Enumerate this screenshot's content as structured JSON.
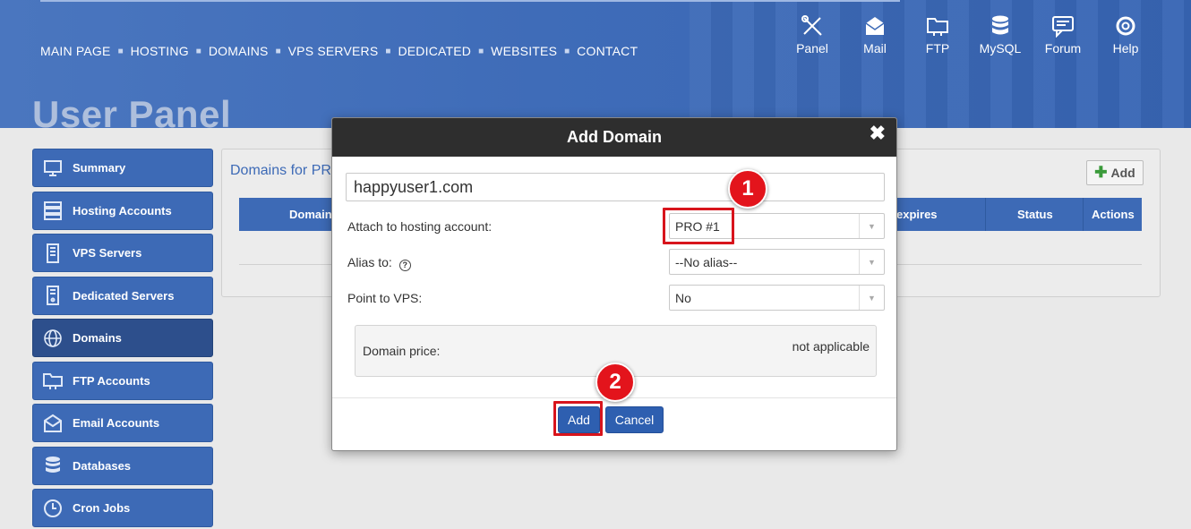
{
  "nav": {
    "items": [
      "MAIN PAGE",
      "HOSTING",
      "DOMAINS",
      "VPS SERVERS",
      "DEDICATED",
      "WEBSITES",
      "CONTACT"
    ],
    "separator": "■"
  },
  "panel_icons": [
    {
      "label": "Panel",
      "icon": "tools-icon"
    },
    {
      "label": "Mail",
      "icon": "mail-icon"
    },
    {
      "label": "FTP",
      "icon": "ftp-folder-icon"
    },
    {
      "label": "MySQL",
      "icon": "database-icon"
    },
    {
      "label": "Forum",
      "icon": "forum-icon"
    },
    {
      "label": "Help",
      "icon": "lifebuoy-icon"
    }
  ],
  "page_title": "User Panel",
  "sidebar": {
    "items": [
      {
        "label": "Summary",
        "icon": "monitor-icon"
      },
      {
        "label": "Hosting Accounts",
        "icon": "server-icon"
      },
      {
        "label": "VPS Servers",
        "icon": "vps-icon"
      },
      {
        "label": "Dedicated Servers",
        "icon": "dedicated-icon"
      },
      {
        "label": "Domains",
        "icon": "www-globe-icon"
      },
      {
        "label": "FTP Accounts",
        "icon": "ftp-folder-icon"
      },
      {
        "label": "Email Accounts",
        "icon": "email-icon"
      },
      {
        "label": "Databases",
        "icon": "database-icon"
      },
      {
        "label": "Cron Jobs",
        "icon": "clock-icon"
      }
    ],
    "active": "Domains"
  },
  "main": {
    "title": "Domains for PR",
    "add_label": "Add",
    "columns": {
      "domain": "Domain",
      "expires": "expires",
      "status": "Status",
      "actions": "Actions"
    }
  },
  "modal": {
    "title": "Add Domain",
    "close": "✖",
    "domain_value": "happyuser1.com",
    "attach_label": "Attach to hosting account:",
    "attach_value": "PRO #1",
    "alias_label": "Alias to:",
    "alias_value": "--No alias--",
    "vps_label": "Point to VPS:",
    "vps_value": "No",
    "price_label": "Domain price:",
    "price_value": "not applicable",
    "add_button": "Add",
    "cancel_button": "Cancel"
  },
  "markers": [
    "1",
    "2"
  ],
  "colors": {
    "accent": "#3d6ab6",
    "highlight": "#d8141c",
    "modal_header": "#2e2e2e"
  }
}
